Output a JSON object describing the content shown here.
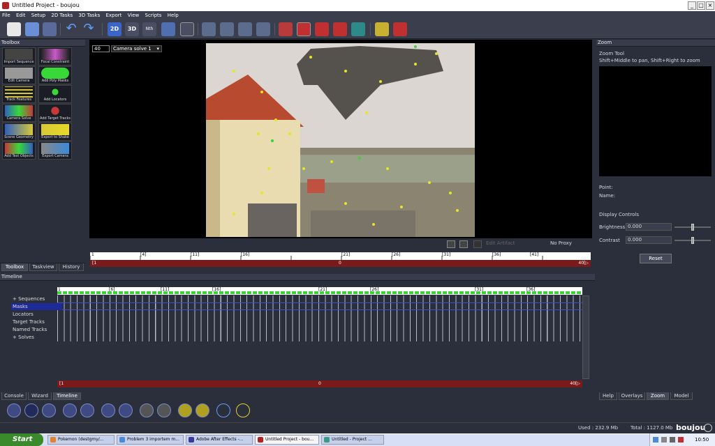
{
  "window": {
    "title": "Untitled Project - boujou"
  },
  "menu": [
    "File",
    "Edit",
    "Setup",
    "2D Tasks",
    "3D Tasks",
    "Export",
    "View",
    "Scripts",
    "Help"
  ],
  "toolbox": {
    "title": "Toolbox",
    "items": [
      "Import Sequence",
      "Focal Constraint",
      "Edit Camera",
      "Add Poly Masks",
      "Track Features",
      "Add Locators",
      "Camera Solve",
      "Add Target Tracks",
      "Scene Geometry",
      "Export to Shake",
      "Add Test Objects",
      "Export Camera"
    ],
    "tabs": [
      "Toolbox",
      "Taskview",
      "History"
    ]
  },
  "viewer": {
    "frame": "40",
    "solve": "Camera solve 1",
    "edit_artifact": "Edit Artifact",
    "proxy": "No Proxy",
    "ruler_ticks": [
      "1",
      "[4]",
      "[11]",
      "[16]",
      "[21]",
      "[26]",
      "[31]",
      "[36]",
      "[41]"
    ],
    "scrub_left": "[1",
    "scrub_mid": "0",
    "scrub_right": "40[▷"
  },
  "zoom": {
    "title": "Zoom",
    "tool": "Zoom Tool",
    "hint": "Shift+Middle to pan, Shift+Right to zoom",
    "point_label": "Point:",
    "name_label": "Name:",
    "display_controls": "Display Controls",
    "brightness_label": "Brightness",
    "brightness_value": "0.000",
    "contrast_label": "Contrast",
    "contrast_value": "0.000",
    "reset": "Reset",
    "tabs": [
      "Help",
      "Overlays",
      "Zoom",
      "Model"
    ]
  },
  "timeline": {
    "title": "Timeline",
    "rows": [
      "Sequences",
      "Masks",
      "Locators",
      "Target Tracks",
      "Named Tracks",
      "Solves"
    ],
    "ruler_ticks": [
      "1",
      "[6]",
      "[11]",
      "[16]",
      "[21]",
      "[26]",
      "[31]",
      "[36]"
    ],
    "scrub_left": "[1",
    "scrub_mid": "0",
    "scrub_right": "40[▷"
  },
  "bottom_tabs": [
    "Console",
    "Wizard",
    "Timeline"
  ],
  "status": {
    "used": "Used : 232.9 Mb",
    "total": "Total : 1127.0 Mb",
    "brand": "boujou"
  },
  "taskbar": {
    "start": "Start",
    "tasks": [
      "Pokemon (destgmy/...",
      "Problem 3 importem m...",
      "Adobe After Effects -...",
      "Untitled Project - bou...",
      "Untitled - Project ..."
    ],
    "clock": "10:50"
  },
  "colors": {
    "track_point": "#e6e622",
    "track_green": "#3ad23a",
    "selected_row": "#1e2a9a"
  }
}
